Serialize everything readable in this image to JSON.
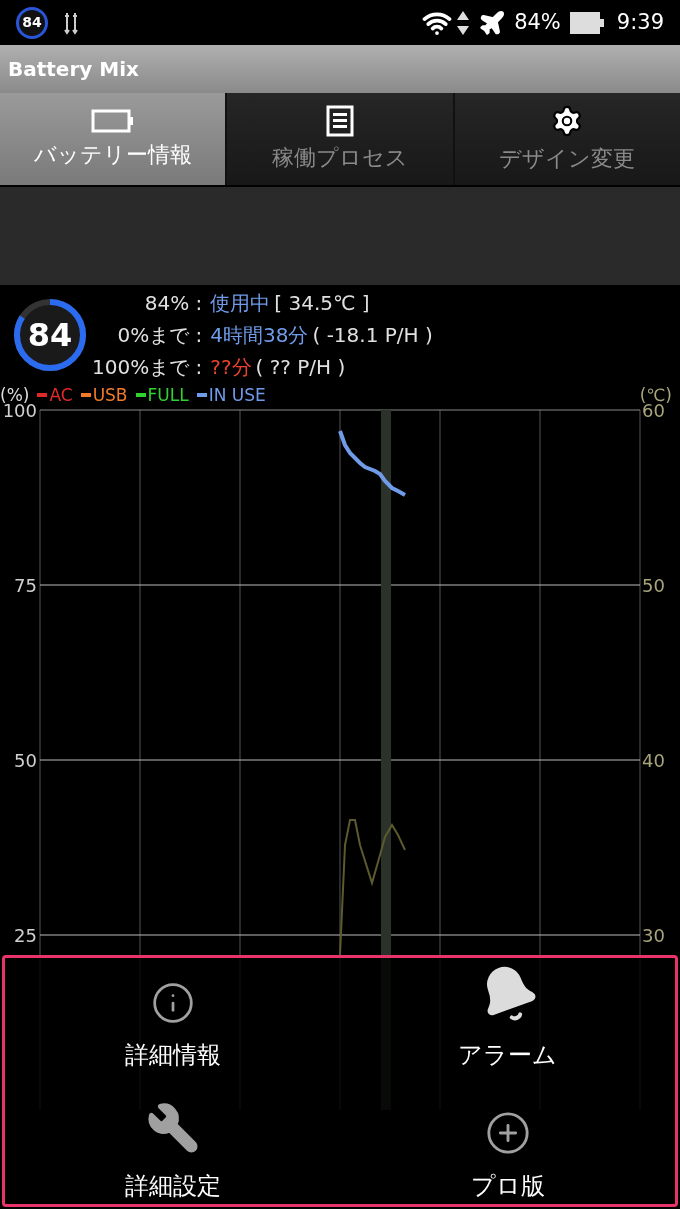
{
  "status_bar": {
    "badge": "84",
    "battery_percent": "84%",
    "time": "9:39"
  },
  "app_bar": {
    "title": "Battery Mix"
  },
  "tabs": [
    {
      "label": "バッテリー情報",
      "kind": "battery",
      "selected": true
    },
    {
      "label": "稼働プロセス",
      "kind": "list",
      "selected": false
    },
    {
      "label": "デザイン変更",
      "kind": "gear",
      "selected": false
    }
  ],
  "summary": {
    "gauge": {
      "text": "84",
      "level": 0.84
    },
    "lines": [
      {
        "label": "84%",
        "separator": ":",
        "value": "使用中",
        "color": "#6f9be8",
        "detail": "[ 34.5℃ ]"
      },
      {
        "label": "0%まで",
        "separator": ":",
        "value": "4時間38分",
        "color": "#6f9be8",
        "detail": "( -18.1 P/H )"
      },
      {
        "label": "100%まで",
        "separator": ":",
        "value": "??分",
        "color": "#e8432f",
        "detail": "( ?? P/H )"
      }
    ]
  },
  "chart": {
    "left_unit": "(%)",
    "right_unit": "(℃)",
    "legend": [
      {
        "label": "AC",
        "color": "#e02a2a"
      },
      {
        "label": "USB",
        "color": "#f07a2a"
      },
      {
        "label": "FULL",
        "color": "#2fd22f"
      },
      {
        "label": "IN USE",
        "color": "#6f9be8"
      }
    ],
    "left_ticks": [
      "100",
      "75",
      "50",
      "25"
    ],
    "right_ticks": [
      "60",
      "50",
      "40",
      "30"
    ]
  },
  "menu": [
    {
      "label": "詳細情報",
      "kind": "info"
    },
    {
      "label": "アラーム",
      "kind": "bell"
    },
    {
      "label": "詳細設定",
      "kind": "wrench"
    },
    {
      "label": "プロ版",
      "kind": "plus"
    }
  ]
}
